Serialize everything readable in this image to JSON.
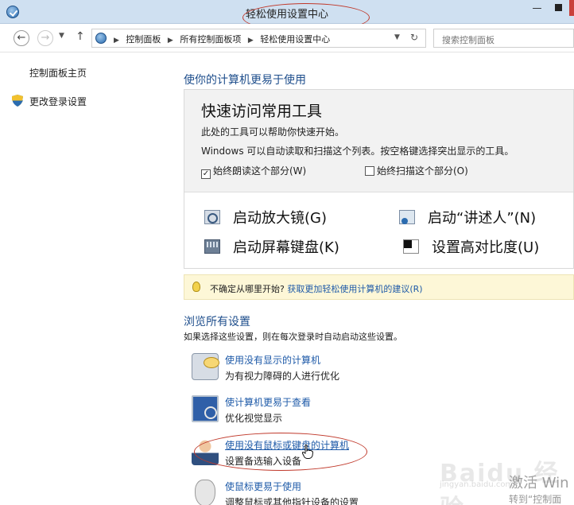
{
  "window": {
    "title": "轻松使用设置中心",
    "minimize_glyph": "—",
    "close_glyph": "×"
  },
  "address": {
    "breadcrumbs": [
      "控制面板",
      "所有控制面板项",
      "轻松使用设置中心"
    ],
    "search_placeholder": "搜索控制面板"
  },
  "sidebar": {
    "home": "控制面板主页",
    "change_login": "更改登录设置"
  },
  "main": {
    "title": "使你的计算机更易于使用",
    "quick_access": {
      "title": "快速访问常用工具",
      "line1": "此处的工具可以帮助你快速开始。",
      "line2": "Windows 可以自动读取和扫描这个列表。按空格键选择突出显示的工具。",
      "check_read": {
        "label": "始终朗读这个部分(W)",
        "checked": "✓"
      },
      "check_scan": {
        "label": "始终扫描这个部分(O)",
        "checked": ""
      },
      "tools": {
        "magnifier": "启动放大镜(G)",
        "narrator": "启动“讲述人”(N)",
        "keyboard": "启动屏幕键盘(K)",
        "contrast": "设置高对比度(U)"
      }
    },
    "tip": {
      "prefix": "不确定从哪里开始?",
      "link": "获取更加轻松使用计算机的建议(R)"
    },
    "browse": {
      "title": "浏览所有设置",
      "subtitle": "如果选择这些设置，则在每次登录时自动启动这些设置。",
      "items": [
        {
          "link": "使用没有显示的计算机",
          "desc": "为有视力障碍的人进行优化"
        },
        {
          "link": "使计算机更易于查看",
          "desc": "优化视觉显示"
        },
        {
          "link": "使用没有鼠标或键盘的计算机",
          "desc": "设置备选输入设备"
        },
        {
          "link": "使鼠标更易于使用",
          "desc": "调整鼠标或其他指针设备的设置"
        }
      ]
    }
  },
  "overlay": {
    "watermark": "Baidu 经验",
    "watermark_sub": "jingyan.baidu.com",
    "activate_title": "激活 Win",
    "activate_sub": "转到“控制面"
  },
  "colors": {
    "link": "#1e5aa8",
    "heading": "#1e4e8c",
    "annotation": "#c0392b"
  }
}
